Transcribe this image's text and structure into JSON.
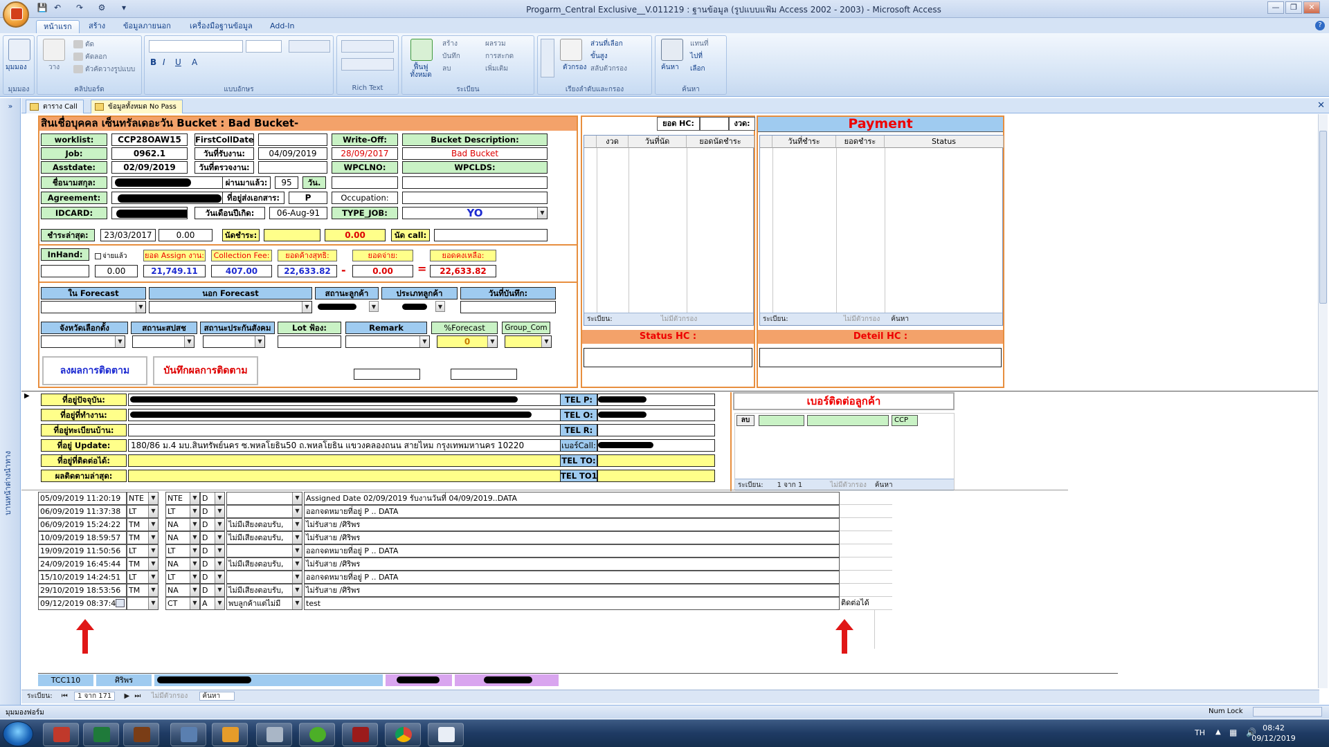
{
  "window": {
    "title": "Progarm_Central Exclusive__V.011219 : ฐานข้อมูล (รูปแบบแฟ้ม Access 2002 - 2003) - Microsoft Access"
  },
  "ribbon": {
    "tabs": [
      "หน้าแรก",
      "สร้าง",
      "ข้อมูลภายนอก",
      "เครื่องมือฐานข้อมูล",
      "Add-In"
    ],
    "groups": {
      "views": {
        "label": "มุมมอง",
        "btn": "มุมมอง"
      },
      "clipboard": {
        "label": "คลิปบอร์ด",
        "paste": "วาง",
        "cut": "ตัด",
        "copy": "คัดลอก",
        "format": "ตัวคัดวางรูปแบบ"
      },
      "font": {
        "label": "แบบอักษร"
      },
      "richtext": {
        "label": "Rich Text"
      },
      "records": {
        "label": "ระเบียน",
        "refresh": "ฟื้นฟู ทั้งหมด",
        "new": "สร้าง",
        "save": "บันทึก",
        "delete": "ลบ",
        "totals": "ผลรวม",
        "spelling": "การสะกด",
        "more": "เพิ่มเติม"
      },
      "sortfilter": {
        "label": "เรียงลำดับและกรอง",
        "filter": "ตัวกรอง",
        "selection": "ส่วนที่เลือก",
        "advanced": "ขั้นสูง",
        "toggle": "สลับตัวกรอง"
      },
      "find": {
        "label": "ค้นหา",
        "find": "ค้นหา",
        "replace": "แทนที่",
        "goto": "ไปที่",
        "select": "เลือก"
      }
    }
  },
  "nav": {
    "toggle": "»",
    "label": "บานหน้าต่างนำทาง"
  },
  "doctabs": [
    {
      "label": "ตาราง Call"
    },
    {
      "label": "ข้อมูลทั้งหมด No Pass"
    }
  ],
  "form": {
    "header": "สินเชื่อบุคคล เซ็นทรัลเดอะวัน  Bucket : Bad Bucket-",
    "worklist_label": "worklist:",
    "worklist": "CCP28OAW15",
    "job_label": "Job:",
    "job": "0962.1",
    "asst_label": "Asstdate:",
    "asstdate": "02/09/2019",
    "name_label": "ชื่อนามสกุล:",
    "agreement_label": "Agreement:",
    "idcard_label": "IDCARD:",
    "firstcall_label": "FirstCollDate:",
    "firstcall": "",
    "recv_label": "วันที่รับงาน:",
    "recvdate": "04/09/2019",
    "check_label": "วันที่ตรวจงาน:",
    "passed_label": "ผ่านมาแล้ว:",
    "passed": "95",
    "day_label": "วัน.",
    "docaddr_label": "ที่อยู่ส่งเอกสาร:",
    "docaddr": "P",
    "birth_label": "วันเดือนปีเกิด:",
    "birth": "06-Aug-91",
    "writeoff_label": "Write-Off:",
    "writeoff": "28/09/2017",
    "wpclno_label": "WPCLNO:",
    "occupation_label": "Occupation:",
    "typejob_label": "TYPE_JOB:",
    "typejob": "YO",
    "bucketdesc_label": "Bucket Description:",
    "bucketdesc": "Bad Bucket",
    "wpclds_label": "WPCLDS:",
    "lastpay_label": "ชำระล่าสุด:",
    "lastpay_date": "23/03/2017",
    "lastpay_amt": "0.00",
    "appt_label": "นัดชำระ:",
    "appt_amt": "0.00",
    "callappt_label": "นัด call:",
    "inhand_label": "InHand:",
    "paid_check": "จ่ายแล้ว",
    "paid_amt": "0.00",
    "assign_label": "ยอด Assign งาน:",
    "assign": "21,749.11",
    "fee_label": "Collection Fee:",
    "fee": "407.00",
    "net_label": "ยอดค้างสุทธิ:",
    "net": "22,633.82",
    "pay_label": "ยอดจ่าย:",
    "pay": "0.00",
    "remain_label": "ยอดคงเหลือ:",
    "remain": "22,633.82",
    "minus": "-",
    "equals": "=",
    "row1_headers": [
      "ใน Forecast",
      "นอก Forecast",
      "สถานะลูกค้า",
      "ประเภทลูกค้า",
      "วันที่บันทึก:"
    ],
    "row2_headers": [
      "จังหวัดเลือกตั้ง",
      "สถานะสปสช",
      "สถานะประกันสังคม",
      "Lot ฟ้อง:",
      "Remark",
      "%Forecast",
      "Group_Com"
    ],
    "forecast_value": "0",
    "btn_log": "ลงผลการติดตาม",
    "btn_save": "บันทึกผลการติดตาม"
  },
  "hc": {
    "hc_label": "ยอด HC:",
    "installment_label": "งวด:",
    "cols": [
      "งวด",
      "วันที่นัด",
      "ยอดนัดชำระ"
    ],
    "nav": "ระเบียน:",
    "nofilter": "ไม่มีตัวกรอง",
    "status_label": "Status HC :"
  },
  "payment": {
    "title": "Payment",
    "cols": [
      "วันที่ชำระ",
      "ยอดชำระ",
      "Status"
    ],
    "nav": "ระเบียน:",
    "nofilter": "ไม่มีตัวกรอง",
    "search": "ค้นหา",
    "detail_label": "Deteil HC :"
  },
  "address": {
    "labels": [
      "ที่อยู่ปัจจุบัน:",
      "ที่อยู่ที่ทำงาน:",
      "ที่อยู่ทะเบียนบ้าน:",
      "ที่อยู่ Update:",
      "ที่อยู่ที่ติดต่อได้:",
      "ผลติดตามล่าสุด:"
    ],
    "update_value": "180/86 ม.4 มบ.สินทรัพย์นคร ซ.พหลโยธิน50 ถ.พหลโยธิน แขวงคลองถนน สายไหม กรุงเทพมหานคร 10220",
    "tel_labels": [
      "TEL P:",
      "TEL O:",
      "TEL R:",
      "เบอร์Call:",
      "TEL TO:",
      "TEL TO1"
    ]
  },
  "contact": {
    "title": "เบอร์ติดต่อลูกค้า",
    "del": "ลบ",
    "ccp": "CCP",
    "nav": "ระเบียน:",
    "pos": "1 จาก 1",
    "nofilter": "ไม่มีตัวกรอง",
    "search": "ค้นหา"
  },
  "log": [
    {
      "dt": "05/09/2019 11:20:19",
      "c1": "NTE",
      "c2": "NTE",
      "c3": "D",
      "c4": "",
      "note": "Assigned Date 02/09/2019 รับงานวันที่ 04/09/2019..DATA",
      "extra": ""
    },
    {
      "dt": "06/09/2019 11:37:38",
      "c1": "LT",
      "c2": "LT",
      "c3": "D",
      "c4": "",
      "note": "ออกจดหมายที่อยู่ P .. DATA",
      "extra": ""
    },
    {
      "dt": "06/09/2019 15:24:22",
      "c1": "TM",
      "c2": "NA",
      "c3": "D",
      "c4": "ไม่มีเสียงตอบรับ,",
      "note": "ไม่รับสาย /ศิริพร",
      "extra": ""
    },
    {
      "dt": "10/09/2019 18:59:57",
      "c1": "TM",
      "c2": "NA",
      "c3": "D",
      "c4": "ไม่มีเสียงตอบรับ,",
      "note": "ไม่รับสาย /ศิริพร",
      "extra": ""
    },
    {
      "dt": "19/09/2019 11:50:56",
      "c1": "LT",
      "c2": "LT",
      "c3": "D",
      "c4": "",
      "note": "ออกจดหมายที่อยู่ P .. DATA",
      "extra": ""
    },
    {
      "dt": "24/09/2019 16:45:44",
      "c1": "TM",
      "c2": "NA",
      "c3": "D",
      "c4": "ไม่มีเสียงตอบรับ,",
      "note": "ไม่รับสาย /ศิริพร",
      "extra": ""
    },
    {
      "dt": "15/10/2019 14:24:51",
      "c1": "LT",
      "c2": "LT",
      "c3": "D",
      "c4": "",
      "note": "ออกจดหมายที่อยู่ P .. DATA",
      "extra": ""
    },
    {
      "dt": "29/10/2019 18:53:56",
      "c1": "TM",
      "c2": "NA",
      "c3": "D",
      "c4": "ไม่มีเสียงตอบรับ,",
      "note": "ไม่รับสาย /ศิริพร",
      "extra": ""
    },
    {
      "dt": "09/12/2019 08:37:46",
      "c1": "",
      "c2": "CT",
      "c3": "A",
      "c4": "พบลูกค้าแต่ไม่มี",
      "note": "test",
      "extra": "ติดต่อได้"
    }
  ],
  "footer": {
    "code": "TCC110",
    "user": "ศิริพร"
  },
  "recordnav": {
    "label": "ระเบียน:",
    "pos": "1 จาก 171",
    "nofilter": "ไม่มีตัวกรอง",
    "search": "ค้นหา"
  },
  "status": {
    "left": "มุมมองฟอร์ม",
    "numlock": "Num Lock"
  },
  "taskbar": {
    "lang": "TH",
    "time": "08:42",
    "date": "09/12/2019"
  }
}
